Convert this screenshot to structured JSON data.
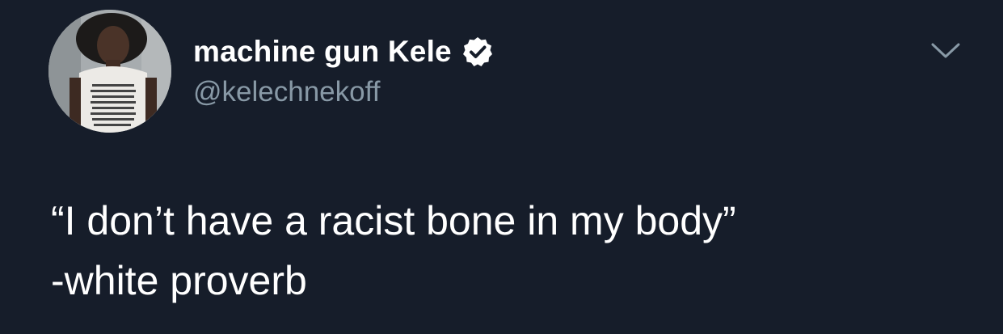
{
  "tweet": {
    "author": {
      "display_name": "machine gun Kele",
      "handle": "@kelechnekoff",
      "verified_icon": "verified-badge-icon",
      "avatar": "avatar-photo"
    },
    "menu_icon": "chevron-down-icon",
    "text_lines": [
      "“I don’t have a racist bone in my body”",
      "-white proverb"
    ]
  },
  "colors": {
    "background": "#161d2a",
    "text": "#ffffff",
    "secondary_text": "#8899a6",
    "verified_badge": "#ffffff",
    "chevron": "#8899a6"
  }
}
